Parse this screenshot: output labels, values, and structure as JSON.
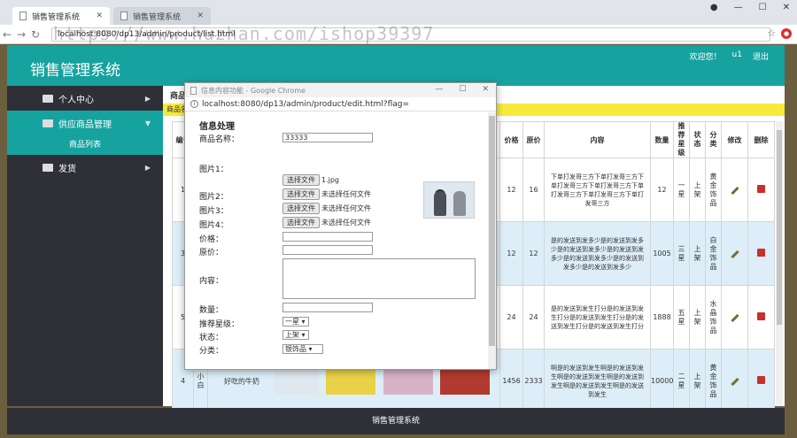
{
  "browser": {
    "tabs": [
      {
        "title": "销售管理系统",
        "active": true
      },
      {
        "title": "销售管理系统",
        "active": false
      }
    ],
    "url": "localhost:8080/dp13/admin/product/list.html",
    "watermark": "https://www.huzhan.com/ishop39397"
  },
  "app": {
    "title": "销售管理系统",
    "welcome": "欢迎您！",
    "username": "u1",
    "logout": "退出",
    "footer": "销售管理系统"
  },
  "sidebar": {
    "items": [
      {
        "label": "个人中心"
      },
      {
        "label": "供应商品管理"
      },
      {
        "label": "发货"
      }
    ],
    "sub_items": [
      {
        "label": "商品列表"
      }
    ]
  },
  "main": {
    "breadcrumb": "商品",
    "yellow_label": "商品名",
    "columns": [
      "编号",
      "",
      "",
      "价格",
      "原价",
      "内容",
      "数量",
      "推荐星级",
      "状态",
      "分类",
      "修改",
      "删除"
    ],
    "rows": [
      {
        "id": "1",
        "price": "12",
        "orig": "16",
        "content": "下单打发哥三方下单打发哥三方下单打发哥三方下单打发哥三方下单打发哥三方下单打发哥三方下单打发哥三方",
        "qty": "12",
        "star": "一星",
        "status": "上架",
        "cat": "黄金饰品"
      },
      {
        "id": "3",
        "price": "12",
        "orig": "12",
        "content": "是的发送到发多少是的发送到发多少是的发送到发多少是的发送到发多少是的发送到发多少是的发送到发多少是的发送到发多少",
        "qty": "1005",
        "star": "三星",
        "status": "上架",
        "cat": "白金饰品"
      },
      {
        "id": "5",
        "price": "24",
        "orig": "24",
        "content": "是的发送到发生打分是的发送到发生打分是的发送到发生打分是的发送到发生打分是的发送到发生打分",
        "qty": "1888",
        "star": "五星",
        "status": "上架",
        "cat": "水晶饰品"
      },
      {
        "id": "4",
        "name_short": "小白",
        "name": "好吃的牛奶",
        "price": "1456",
        "orig": "2333",
        "content": "啊是的发送到发生啊是的发送到发生啊是的发送到发生啊是的发送到发生啊是的发送到发生啊是的发送到发生",
        "qty": "10000",
        "star": "二星",
        "status": "上架",
        "cat": "黄金饰品"
      }
    ]
  },
  "popup": {
    "window_title": "信息内容功能 - Google Chrome",
    "url": "localhost:8080/dp13/admin/product/edit.html?flag=",
    "heading": "信息处理",
    "labels": {
      "name": "商品名称：",
      "img1": "图片1：",
      "img2": "图片2：",
      "img3": "图片3：",
      "img4": "图片4：",
      "price": "价格：",
      "orig": "原价：",
      "content": "内容：",
      "qty": "数量：",
      "star": "推荐星级：",
      "status": "状态：",
      "cat": "分类："
    },
    "name_value": "33333",
    "choose_file": "选择文件",
    "img1_file": "1.jpg",
    "no_file": "未选择任何文件",
    "star_value": "一星",
    "status_value": "上架",
    "cat_value": "银饰品"
  }
}
